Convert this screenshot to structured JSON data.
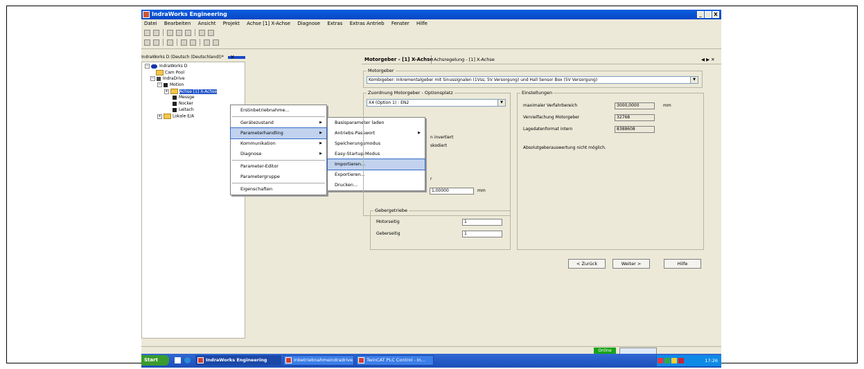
{
  "window": {
    "title": "IndraWorks Engineering",
    "controls": [
      "_",
      " ",
      "X"
    ]
  },
  "menubar": [
    "Datei",
    "Bearbeiten",
    "Ansicht",
    "Projekt",
    "Achse [1] X-Achse",
    "Diagnose",
    "Extras",
    "Extras Antrieb",
    "Fenster",
    "Hilfe"
  ],
  "left_panel": {
    "header": "IndraWorks D (Deutsch (Deutschland))*",
    "tree": {
      "root": "IndraWorks D",
      "cam_pool": "Cam Pool",
      "indradrive": "IndraDrive",
      "motion": "Motion",
      "achse": "Achse [1] X-Achse",
      "messge": "Messge",
      "nocker": "Nocker",
      "leitach": "Leitach",
      "lokale": "Lokale E/A"
    }
  },
  "context_menu": {
    "items": [
      "Erstinbetriebnahme...",
      "Gerätezustand",
      "Parameterhandling",
      "Kommunikation",
      "Diagnose",
      "Parameter-Editor",
      "Parametergruppe",
      "Eigenschaften"
    ]
  },
  "submenu": {
    "items": [
      "Basisparameter laden",
      "Antriebs-Passwort",
      "Speicherungsmodus",
      "Easy-Startup-Modus",
      "Importieren...",
      "Exportieren...",
      "Drucken..."
    ]
  },
  "right_panel": {
    "tab_active": "Motorgeber - [1] X-Achse",
    "tab_other": "Achsregelung - [1] X-Achse",
    "motorgeber_label": "Motorgeber",
    "motorgeber_value": "Kombigeber: Inkrementalgeber mit Sinussignalen (1Vss; 5V Versorgung) und Hall Sensor Box (5V Versorgung)",
    "zuordnung_label": "Zuordnung Motorgeber - Optionsplatz",
    "zuordnung_value": "X4 (Option 1)  :  EN2",
    "partial_1": "n invertiert",
    "partial_2": "skodiert",
    "partial_3": "r",
    "teilung_value": "1,00000",
    "teilung_unit": "mm",
    "einstellungen_label": "Einstellungen",
    "max_verfahr_label": "maximaler Verfahrbereich",
    "max_verfahr_value": "3000,0000",
    "max_verfahr_unit": "mm",
    "vervielf_label": "Vervielfachung Motorgeber",
    "vervielf_value": "32768",
    "lagedaten_label": "Lagedatenformat intern",
    "lagedaten_value": "8388608",
    "absolut_note": "Absolutgeberauswertung nicht möglich.",
    "getriebe_label": "Gebergetriebe",
    "motorseitig_label": "Motorseitig",
    "motorseitig_value": "1",
    "geberseitig_label": "Geberseitig",
    "geberseitig_value": "1",
    "zurueck": "< Zurück",
    "weiter": "Weiter >",
    "hilfe": "Hilfe"
  },
  "status": {
    "online": "Online"
  },
  "taskbar": {
    "start": "Start",
    "tasks": [
      "IndraWorks Engineering",
      "Inbetriebnahmeindradrive...",
      "TwinCAT PLC Control - In..."
    ],
    "clock": "17:26"
  }
}
